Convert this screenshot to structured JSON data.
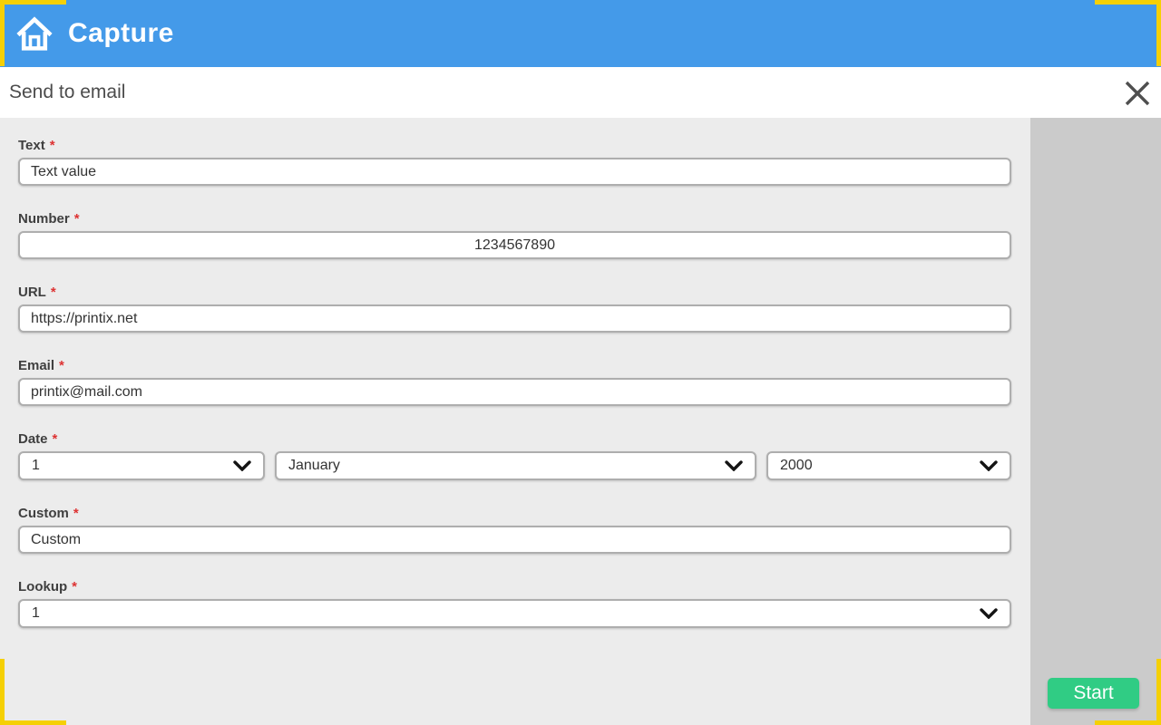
{
  "colors": {
    "header_blue": "#449ae9",
    "corner_yellow": "#f5d005",
    "start_green": "#30cc84",
    "form_panel_gray": "#ececec",
    "sidebar_gray": "#cbcbcb",
    "required_red": "#dd3333"
  },
  "icons": {
    "home": "home-icon",
    "close": "close-icon",
    "chevron": "chevron-down-icon"
  },
  "header": {
    "title": "Capture"
  },
  "dialog": {
    "title": "Send to email"
  },
  "form": {
    "fields": [
      {
        "label": "Text",
        "required": "*",
        "type": "text",
        "value": "Text value"
      },
      {
        "label": "Number",
        "required": "*",
        "type": "number",
        "value": "1234567890"
      },
      {
        "label": "URL",
        "required": "*",
        "type": "url",
        "value": "https://printix.net"
      },
      {
        "label": "Email",
        "required": "*",
        "type": "email",
        "value": "printix@mail.com"
      },
      {
        "label": "Date",
        "required": "*",
        "type": "date",
        "day": "1",
        "month": "January",
        "year": "2000"
      },
      {
        "label": "Custom",
        "required": "*",
        "type": "text",
        "value": "Custom"
      },
      {
        "label": "Lookup",
        "required": "*",
        "type": "select",
        "value": "1"
      }
    ]
  },
  "actions": {
    "start_label": "Start"
  }
}
